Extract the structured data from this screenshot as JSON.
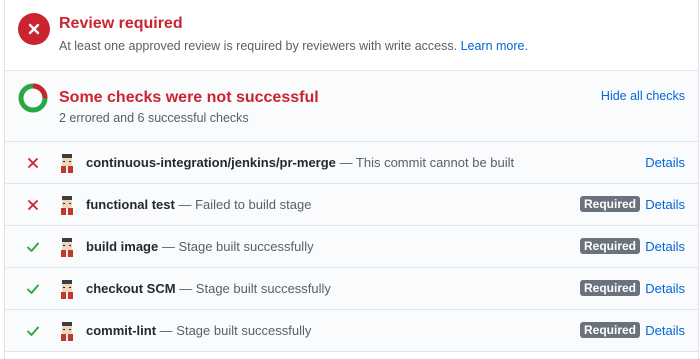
{
  "review": {
    "title": "Review required",
    "description": "At least one approved review is required by reviewers with write access.",
    "learn_more": "Learn more."
  },
  "checks": {
    "title": "Some checks were not successful",
    "summary": "2 errored and 6 successful checks",
    "hide_all": "Hide all checks",
    "items": [
      {
        "status": "failure",
        "name": "continuous-integration/jenkins/pr-merge",
        "description": " — This commit cannot be built",
        "required": false,
        "required_label": "",
        "details": "Details"
      },
      {
        "status": "failure",
        "name": "functional test",
        "description": " — Failed to build stage",
        "required": true,
        "required_label": "Required",
        "details": "Details"
      },
      {
        "status": "success",
        "name": "build image",
        "description": " — Stage built successfully",
        "required": true,
        "required_label": "Required",
        "details": "Details"
      },
      {
        "status": "success",
        "name": "checkout SCM",
        "description": " — Stage built successfully",
        "required": true,
        "required_label": "Required",
        "details": "Details"
      },
      {
        "status": "success",
        "name": "commit-lint",
        "description": " — Stage built successfully",
        "required": true,
        "required_label": "Required",
        "details": "Details"
      }
    ]
  },
  "colors": {
    "error": "#cb2431",
    "success": "#28a745",
    "link": "#0366d6",
    "required_badge": "#6a737d"
  },
  "icons": {
    "review_badge": "x-circle-icon",
    "checks_status": "status-donut-icon",
    "failure": "x-icon",
    "success": "check-icon",
    "avatar": "jenkins-avatar-icon"
  }
}
